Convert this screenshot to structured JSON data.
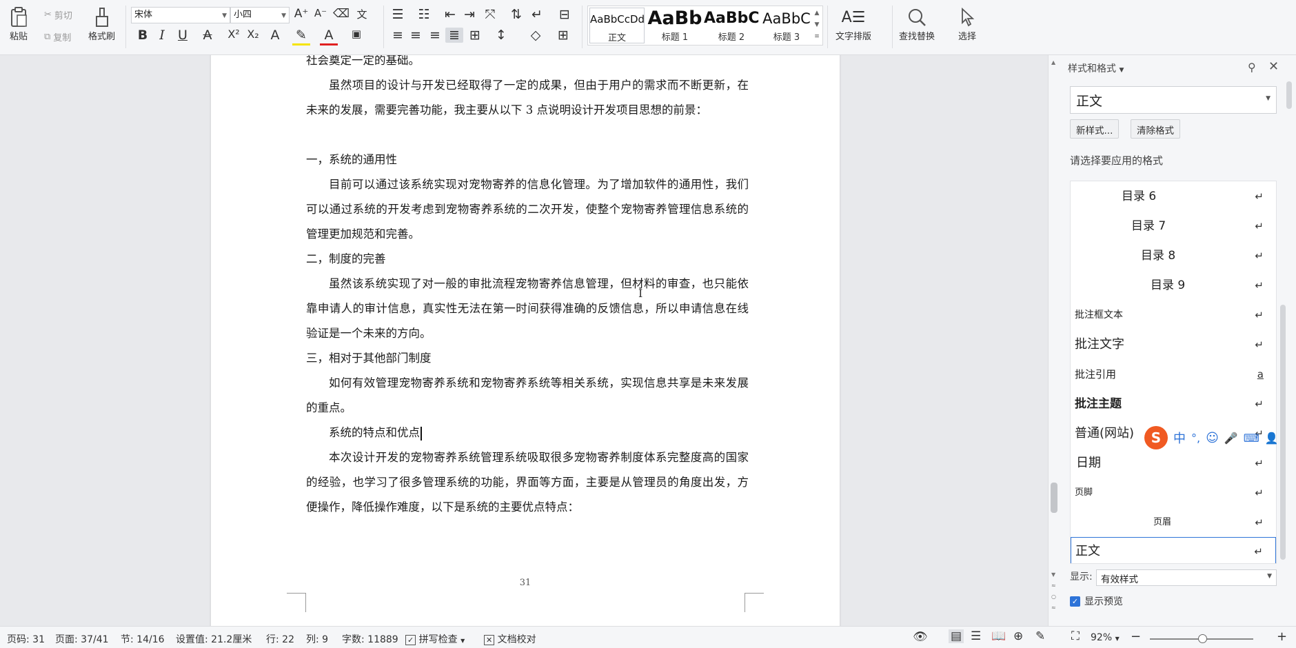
{
  "ribbon": {
    "paste": "粘贴",
    "cut": "剪切",
    "copy": "复制",
    "format_painter": "格式刷",
    "font_name": "宋体",
    "font_size": "小四",
    "styles": [
      {
        "preview": "AaBbCcDd",
        "label": "正文"
      },
      {
        "preview": "AaBb",
        "label": "标题 1"
      },
      {
        "preview": "AaBbC",
        "label": "标题 2"
      },
      {
        "preview": "AaBbC",
        "label": "标题 3"
      }
    ],
    "text_layout": "文字排版",
    "find_replace": "查找替换",
    "select": "选择"
  },
  "document": {
    "paragraphs": [
      "社会奠定一定的基础。",
      "虽然项目的设计与开发已经取得了一定的成果，但由于用户的需求而不断更新，在未来的发展，需要完善功能，我主要从以下 3 点说明设计开发项目思想的前景：",
      "一，系统的通用性",
      "目前可以通过该系统实现对宠物寄养的信息化管理。为了增加软件的通用性，我们可以通过系统的开发考虑到宠物寄养系统的二次开发，使整个宠物寄养管理信息系统的管理更加规范和完善。",
      "二，制度的完善",
      "虽然该系统实现了对一般的审批流程宠物寄养信息管理，但材料的审查，也只能依靠申请人的审计信息，真实性无法在第一时间获得准确的反馈信息，所以申请信息在线验证是一个未来的方向。",
      "三，相对于其他部门制度",
      "如何有效管理宠物寄养系统和宠物寄养系统等相关系统，实现信息共享是未来发展的重点。",
      "系统的特点和优点",
      "本次设计开发的宠物寄养系统管理系统吸取很多宠物寄养制度体系完整度高的国家的经验，也学习了很多管理系统的功能，界面等方面，主要是从管理员的角度出发，方便操作，降低操作难度，以下是系统的主要优点特点："
    ],
    "page_number": "31"
  },
  "panel": {
    "title": "样式和格式",
    "current_style": "正文",
    "new_style": "新样式...",
    "clear_format": "清除格式",
    "choose_label": "请选择要应用的格式",
    "styles": [
      {
        "name": "目录 6",
        "mark": "↵"
      },
      {
        "name": "目录 7",
        "mark": "↵"
      },
      {
        "name": "目录 8",
        "mark": "↵"
      },
      {
        "name": "目录 9",
        "mark": "↵"
      },
      {
        "name": "批注框文本",
        "mark": "↵"
      },
      {
        "name": "批注文字",
        "mark": "↵"
      },
      {
        "name": "批注引用",
        "mark": "a"
      },
      {
        "name": "批注主题",
        "mark": "↵"
      },
      {
        "name": "普通(网站)",
        "mark": "↵"
      },
      {
        "name": "日期",
        "mark": "↵"
      },
      {
        "name": "页脚",
        "mark": "↵"
      },
      {
        "name": "页眉",
        "mark": "↵"
      },
      {
        "name": "正文",
        "mark": "↵"
      }
    ],
    "show_label": "显示:",
    "show_value": "有效样式",
    "show_preview": "显示预览"
  },
  "ime": {
    "logo": "S",
    "lang": "中"
  },
  "status": {
    "page_code": "页码: 31",
    "pages": "页面: 37/41",
    "section": "节: 14/16",
    "setting": "设置值: 21.2厘米",
    "row": "行: 22",
    "col": "列: 9",
    "word_count": "字数: 11889",
    "spell_check": "拼写检查",
    "doc_check": "文档校对",
    "zoom": "92%"
  }
}
